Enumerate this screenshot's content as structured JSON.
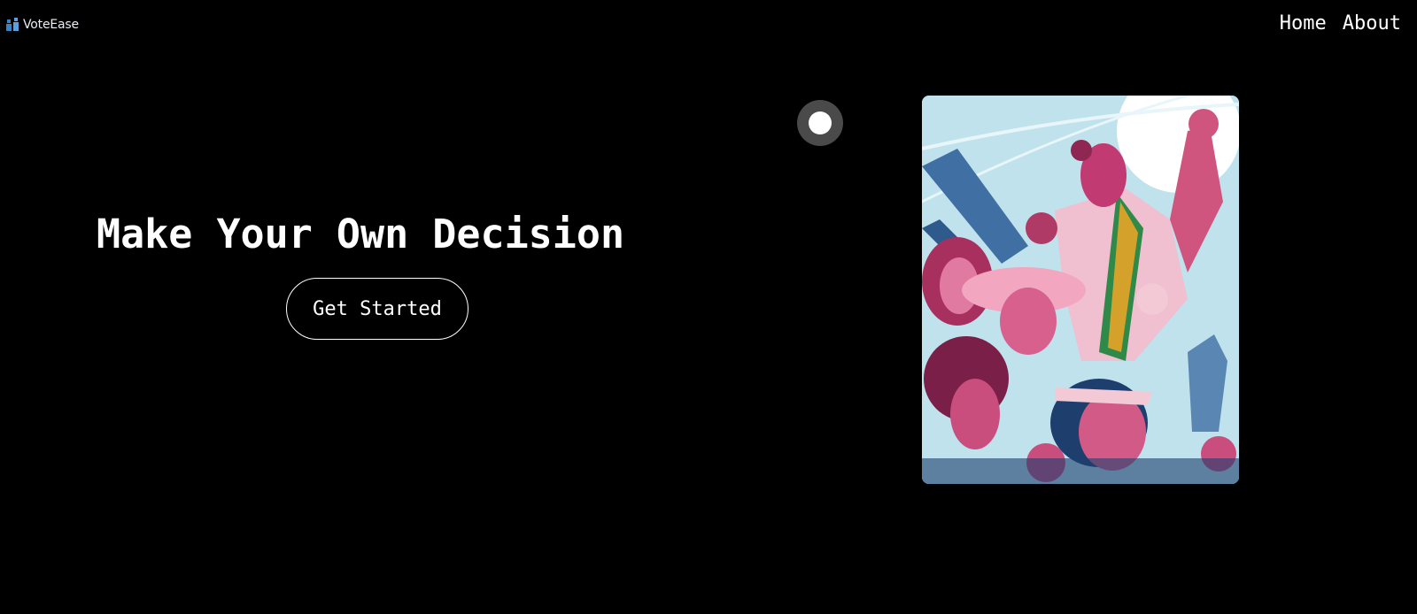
{
  "header": {
    "logo_text": "VoteEase",
    "logo_icon": "voters-icon",
    "nav": [
      {
        "label": "Home"
      },
      {
        "label": "About"
      }
    ]
  },
  "hero": {
    "title": "Make Your Own Decision",
    "cta_label": "Get Started"
  },
  "indicator": {
    "icon": "circle-toggle-icon"
  },
  "poster": {
    "subject": "protest-illustration"
  },
  "colors": {
    "background": "#000000",
    "text": "#ffffff",
    "indicator_ring": "#4a4a4a",
    "poster_sky": "#bfe2ec",
    "poster_magenta": "#c23a72",
    "poster_navy": "#1e3f6e"
  }
}
